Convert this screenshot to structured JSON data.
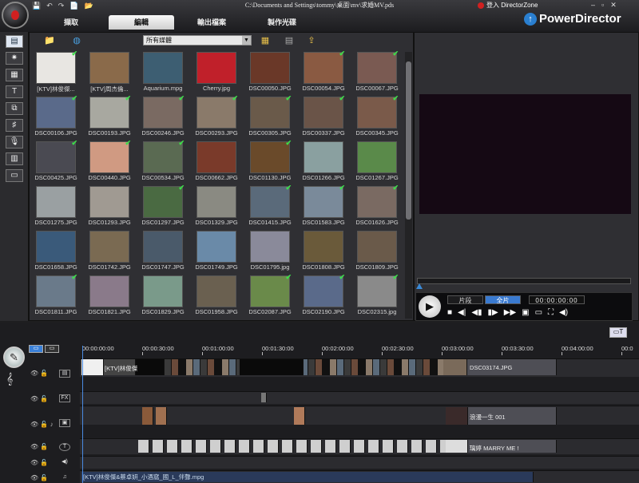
{
  "window": {
    "title": "C:\\Documents and Settings\\tommy\\桌面\\mv\\求婚MV.pds",
    "directorzone": "登入 DirectorZone",
    "brand": "PowerDirector",
    "controls": [
      "–",
      "▫",
      "✕"
    ]
  },
  "quick_access": [
    "💾",
    "↶",
    "↷",
    "📄",
    "📂"
  ],
  "tabs": [
    {
      "label": "擷取"
    },
    {
      "label": "編輯",
      "active": true
    },
    {
      "label": "輸出檔案"
    },
    {
      "label": "製作光碟"
    }
  ],
  "library": {
    "filter_value": "所有媒體",
    "toolbar_icons": [
      "folder-icon",
      "globe-icon",
      "storyboard-icon",
      "film-strip-icon",
      "export-icon"
    ],
    "items": [
      {
        "name": "[KTV]林俊傑...",
        "checked": true,
        "color": "#e8e6e2"
      },
      {
        "name": "[KTV]周杰倫...",
        "checked": false,
        "color": "#8a6a4a"
      },
      {
        "name": "Aquarium.mpg",
        "checked": false,
        "color": "#3d5e72"
      },
      {
        "name": "Cherry.jpg",
        "checked": false,
        "color": "#c0202a"
      },
      {
        "name": "DSC00050.JPG",
        "checked": false,
        "color": "#6a3828"
      },
      {
        "name": "DSC00054.JPG",
        "checked": true,
        "color": "#8a5a42"
      },
      {
        "name": "DSC00067.JPG",
        "checked": true,
        "color": "#7a5a52"
      },
      {
        "name": "DSC00106.JPG",
        "checked": true,
        "color": "#5a6a8a"
      },
      {
        "name": "DSC00193.JPG",
        "checked": true,
        "color": "#a8a8a0"
      },
      {
        "name": "DSC00246.JPG",
        "checked": true,
        "color": "#7a6a62"
      },
      {
        "name": "DSC00293.JPG",
        "checked": true,
        "color": "#8a7a6a"
      },
      {
        "name": "DSC00305.JPG",
        "checked": true,
        "color": "#6a5a4a"
      },
      {
        "name": "DSC00337.JPG",
        "checked": true,
        "color": "#6a5448"
      },
      {
        "name": "DSC00345.JPG",
        "checked": true,
        "color": "#7a5a4a"
      },
      {
        "name": "DSC00425.JPG",
        "checked": true,
        "color": "#4a4a52"
      },
      {
        "name": "DSC00440.JPG",
        "checked": true,
        "color": "#d09a82"
      },
      {
        "name": "DSC00534.JPG",
        "checked": true,
        "color": "#5a6a52"
      },
      {
        "name": "DSC00662.JPG",
        "checked": false,
        "color": "#7a3a2a"
      },
      {
        "name": "DSC01130.JPG",
        "checked": true,
        "color": "#6a4a2a"
      },
      {
        "name": "DSC01266.JPG",
        "checked": false,
        "color": "#8aa0a0"
      },
      {
        "name": "DSC01267.JPG",
        "checked": false,
        "color": "#5a8a4a"
      },
      {
        "name": "DSC01275.JPG",
        "checked": false,
        "color": "#9aa0a2"
      },
      {
        "name": "DSC01293.JPG",
        "checked": false,
        "color": "#a09a92"
      },
      {
        "name": "DSC01297.JPG",
        "checked": true,
        "color": "#4a6a42"
      },
      {
        "name": "DSC01329.JPG",
        "checked": false,
        "color": "#8a8a82"
      },
      {
        "name": "DSC01415.JPG",
        "checked": true,
        "color": "#5a6a7a"
      },
      {
        "name": "DSC01583.JPG",
        "checked": true,
        "color": "#7a8a9a"
      },
      {
        "name": "DSC01626.JPG",
        "checked": true,
        "color": "#7a6a62"
      },
      {
        "name": "DSC01658.JPG",
        "checked": false,
        "color": "#3a5a7a"
      },
      {
        "name": "DSC01742.JPG",
        "checked": false,
        "color": "#7a6a52"
      },
      {
        "name": "DSC01747.JPG",
        "checked": false,
        "color": "#4a5a6a"
      },
      {
        "name": "DSC01749.JPG",
        "checked": false,
        "color": "#6a8aa8"
      },
      {
        "name": "DSC01795.jpg",
        "checked": false,
        "color": "#8a8a9a"
      },
      {
        "name": "DSC01808.JPG",
        "checked": false,
        "color": "#6a5a3a"
      },
      {
        "name": "DSC01809.JPG",
        "checked": false,
        "color": "#6a5a4a"
      },
      {
        "name": "DSC01811.JPG",
        "checked": true,
        "color": "#6a7a8a"
      },
      {
        "name": "DSC01821.JPG",
        "checked": false,
        "color": "#8a7a8a"
      },
      {
        "name": "DSC01829.JPG",
        "checked": false,
        "color": "#7a9a8a"
      },
      {
        "name": "DSC01958.JPG",
        "checked": false,
        "color": "#6a6050"
      },
      {
        "name": "DSC02087.JPG",
        "checked": true,
        "color": "#6a8a4a"
      },
      {
        "name": "DSC02190.JPG",
        "checked": true,
        "color": "#5a6a8a"
      },
      {
        "name": "DSC02315.jpg",
        "checked": true,
        "color": "#8a8a8a"
      }
    ]
  },
  "preview": {
    "mode_clip": "片段",
    "mode_movie": "全片",
    "timecode": "00:00:00:00",
    "controls": [
      "■",
      "◀|",
      "◀▮",
      "▮▶",
      "▶▶",
      "▣",
      "▭",
      "⛶",
      "◀)"
    ]
  },
  "timeline": {
    "ruler": [
      "00:00:00:00",
      "00:00:30:00",
      "00:01:00:00",
      "00:01:30:00",
      "00:02:00:00",
      "00:02:30:00",
      "00:03:00:00",
      "00:03:30:00",
      "00:04:00:00",
      "00:0"
    ],
    "video_label_start": "[KTV]林俊傑",
    "video_label_end": "DSC03174.JPG",
    "overlay_label": "浪漫一生 001",
    "title_label": "璃婷 MARRY ME !",
    "music_label": "[KTV]林俊傑&蔡卓妍_小酒窩_國_L_伴聲.mpg"
  },
  "colors": {
    "accent": "#3a7ad0",
    "check": "#3ce04a"
  }
}
